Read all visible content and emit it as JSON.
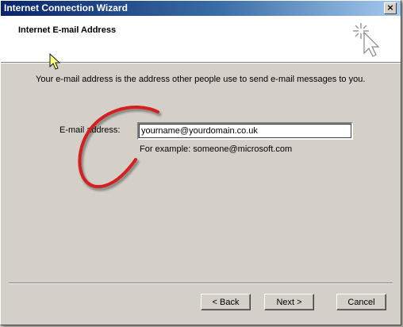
{
  "window": {
    "title": "Internet Connection Wizard",
    "close_glyph": "×"
  },
  "header": {
    "title": "Internet E-mail Address",
    "icon": "wizard-sparkle-cursor-icon"
  },
  "main": {
    "description": "Your e-mail address is the address other people use to send e-mail messages to you.",
    "email_label": "E-mail address:",
    "email_value": "yourname@yourdomain.co.uk",
    "example_text": "For example: someone@microsoft.com"
  },
  "footer": {
    "back_label": "< Back",
    "next_label": "Next >",
    "cancel_label": "Cancel"
  },
  "colors": {
    "title_bar_start": "#0a246a",
    "title_bar_end": "#a6caf0",
    "dialog_face": "#d4d0c8",
    "annotation_circle": "#d42020",
    "pointer_highlight": "#ffff99"
  }
}
